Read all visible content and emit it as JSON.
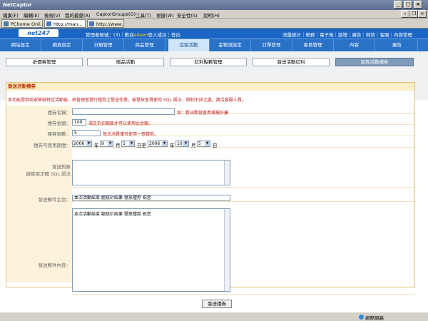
{
  "window": {
    "title": "NetCaptor"
  },
  "menu": [
    "檔案(F)",
    "編輯(E)",
    "檢視(V)",
    "我的最愛(A)",
    "CaptorGroups(G)",
    "工具(T)",
    "視窗(W)",
    "安全性(S)",
    "說明(H)"
  ],
  "browser_tabs": [
    "PChome Onli...",
    "http://man...",
    "http://www..."
  ],
  "site": {
    "logo": "net247",
    "user_prefix": "管理者帳號：(",
    "user_name": "3",
    "user_suffix": ")",
    "divider1": "｜",
    "login_text": "歡迎",
    "login_name": "aileen",
    "login_suffix": "登入成功",
    "divider2": "｜",
    "logout": "登出",
    "top_links": [
      "流量統計",
      "｜",
      "帳務",
      "｜",
      "電子報",
      "｜",
      "論壇",
      "｜",
      "廣告",
      "｜",
      "問答",
      "｜",
      "客服",
      "｜",
      "內容管理"
    ]
  },
  "main_nav": [
    "網站設定",
    "網頁設定",
    "分類管理",
    "商品管理",
    "促銷活動",
    "金物流設定",
    "訂單管理",
    "會員管理",
    "內容",
    "廣告"
  ],
  "main_nav_active": 4,
  "sub_nav": [
    "折價券管理",
    "贈品活動",
    "紅利點數管理",
    "發送活動紅利",
    "發放活動禮券"
  ],
  "sub_nav_active": 4,
  "panel": {
    "heading": "發送活動禮券",
    "notice": "本功能提供商家舉辦特定活動後，由管理者發行禮券之發送作業，被發放會員使用 SQL 語法，限制不詳之處，請洽客服人員。"
  },
  "form": {
    "name_label": "禮券名稱：",
    "name_value": "",
    "name_hint": "如：新站開幕會員專屬好康",
    "amount_label": "禮券金額：",
    "amount_value": "100",
    "amount_hint": "滿足折扣額度才可以使用此金額。",
    "count_label": "禮券張數：",
    "count_value": "5",
    "count_hint": "每次消費僅可使用一張禮券。",
    "period_label": "禮券可使用期間：",
    "start_year": "2006",
    "start_month": "9",
    "start_day": "5",
    "end_year": "2006",
    "end_month": "10",
    "end_day": "5",
    "unit_year": "年",
    "unit_month": "月",
    "unit_day": "日",
    "unit_to": "日至",
    "target_label1": "發送對象",
    "target_label2": "請使用正確 SQL 語法",
    "target_value": "",
    "subject_label": "發送郵件主旨：",
    "subject_value": "本次活動結束 經統計結果 發放禮券 祝您",
    "body_label": "發送郵件內容：",
    "body_value": "本次活動結束 經統計結果 發放禮券 祝您",
    "submit": "發送禮券"
  },
  "status": {
    "zone": "網際網路"
  }
}
